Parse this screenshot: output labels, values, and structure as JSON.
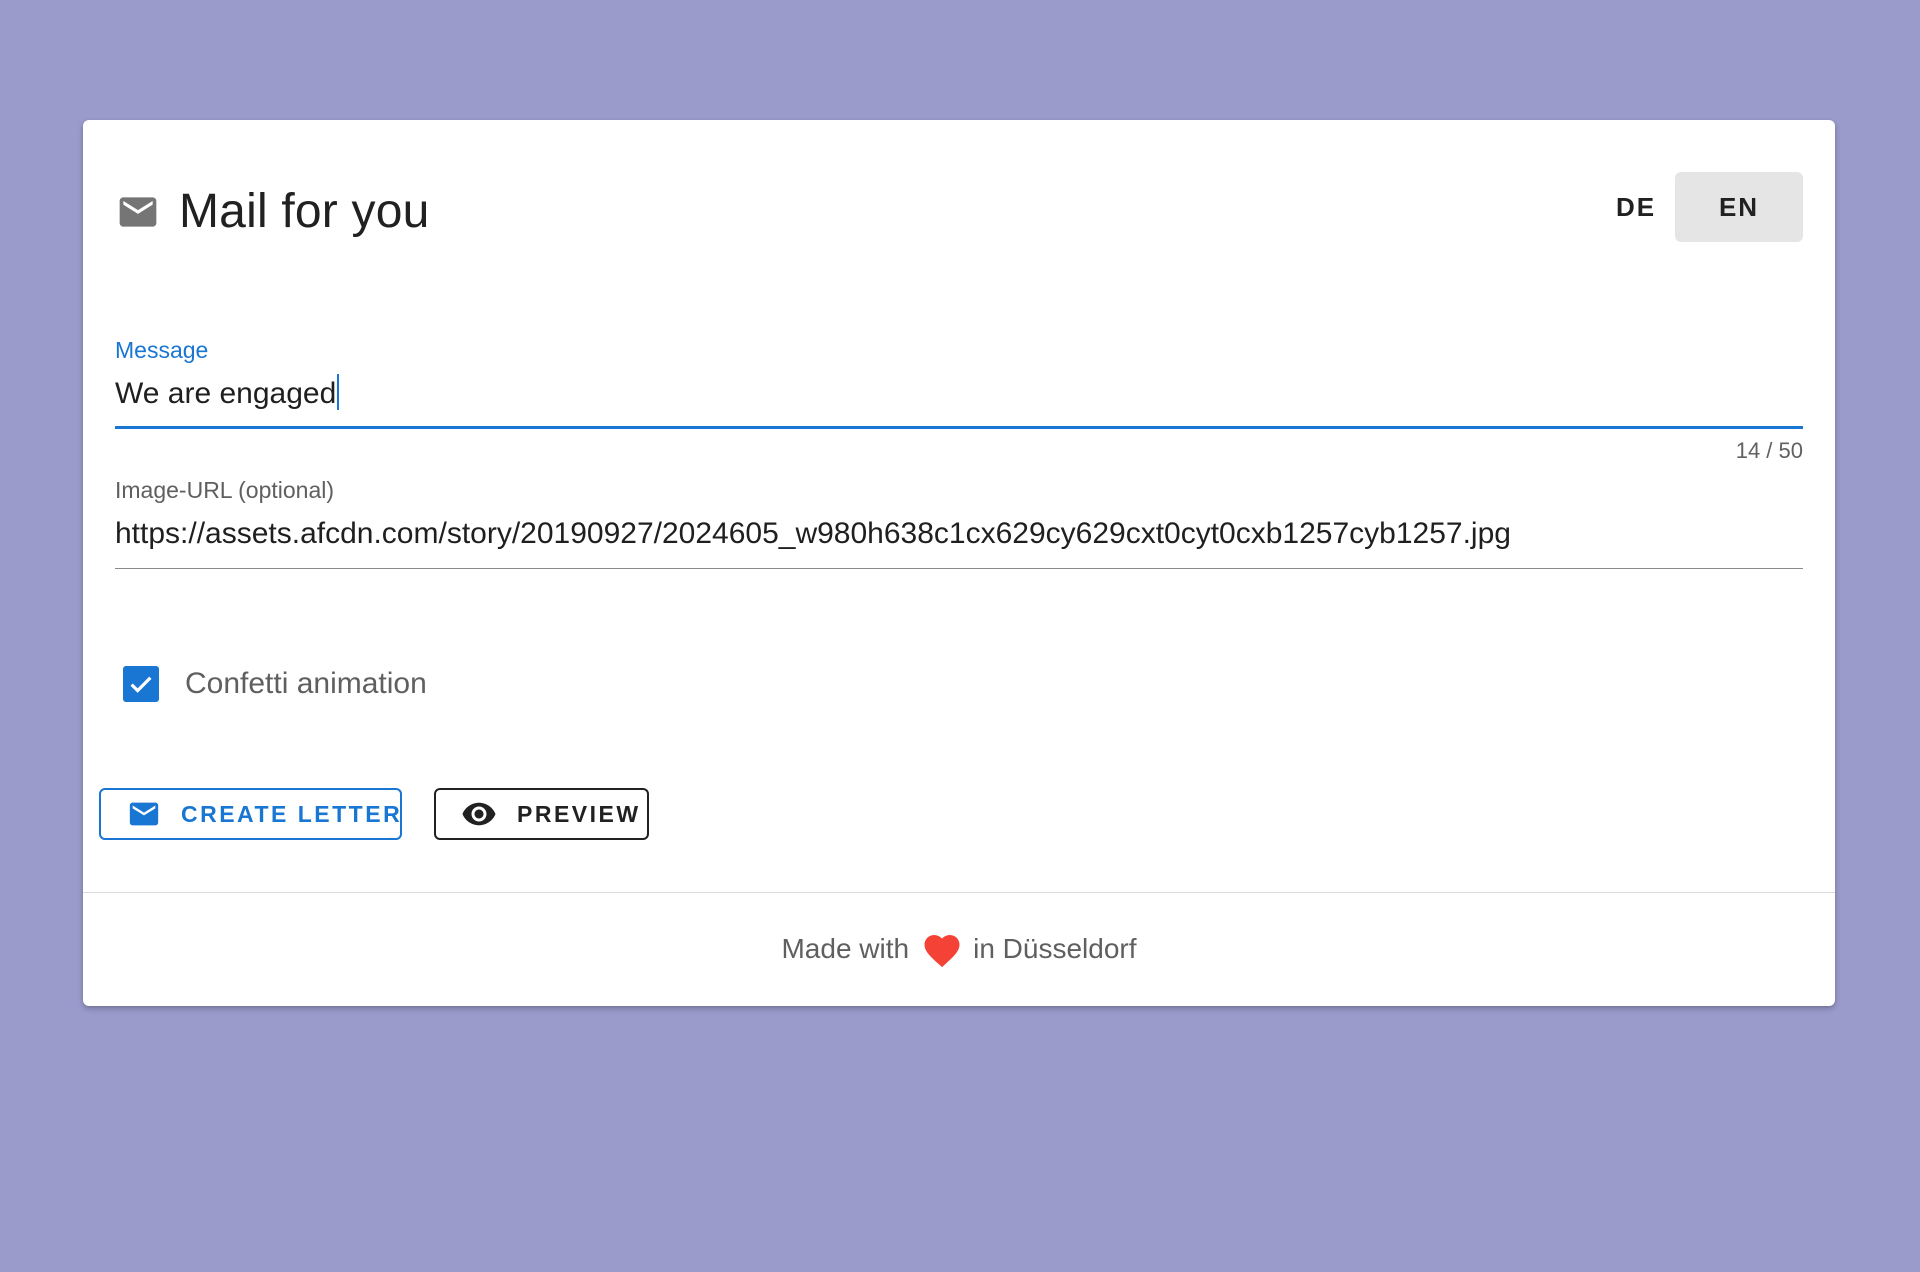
{
  "app": {
    "title": "Mail for you",
    "icon": "mail-icon"
  },
  "language": {
    "options": [
      "DE",
      "EN"
    ],
    "selected": "EN"
  },
  "form": {
    "message": {
      "label": "Message",
      "value": "We are engaged",
      "counter": "14 / 50",
      "focused": true
    },
    "image_url": {
      "label": "Image-URL (optional)",
      "value": "https://assets.afcdn.com/story/20190927/2024605_w980h638c1cx629cy629cxt0cyt0cxb1257cyb1257.jpg"
    },
    "confetti": {
      "label": "Confetti animation",
      "checked": true
    }
  },
  "actions": {
    "create_label": "CREATE LETTER",
    "create_icon": "mail-icon",
    "preview_label": "PREVIEW",
    "preview_icon": "eye-icon"
  },
  "footer": {
    "prefix": "Made with",
    "icon": "heart-icon",
    "suffix": "in Düsseldorf"
  },
  "colors": {
    "background": "#9a9acb",
    "accent": "#1976d2",
    "heart": "#f44336",
    "selected_lang_bg": "#e5e5e5"
  }
}
